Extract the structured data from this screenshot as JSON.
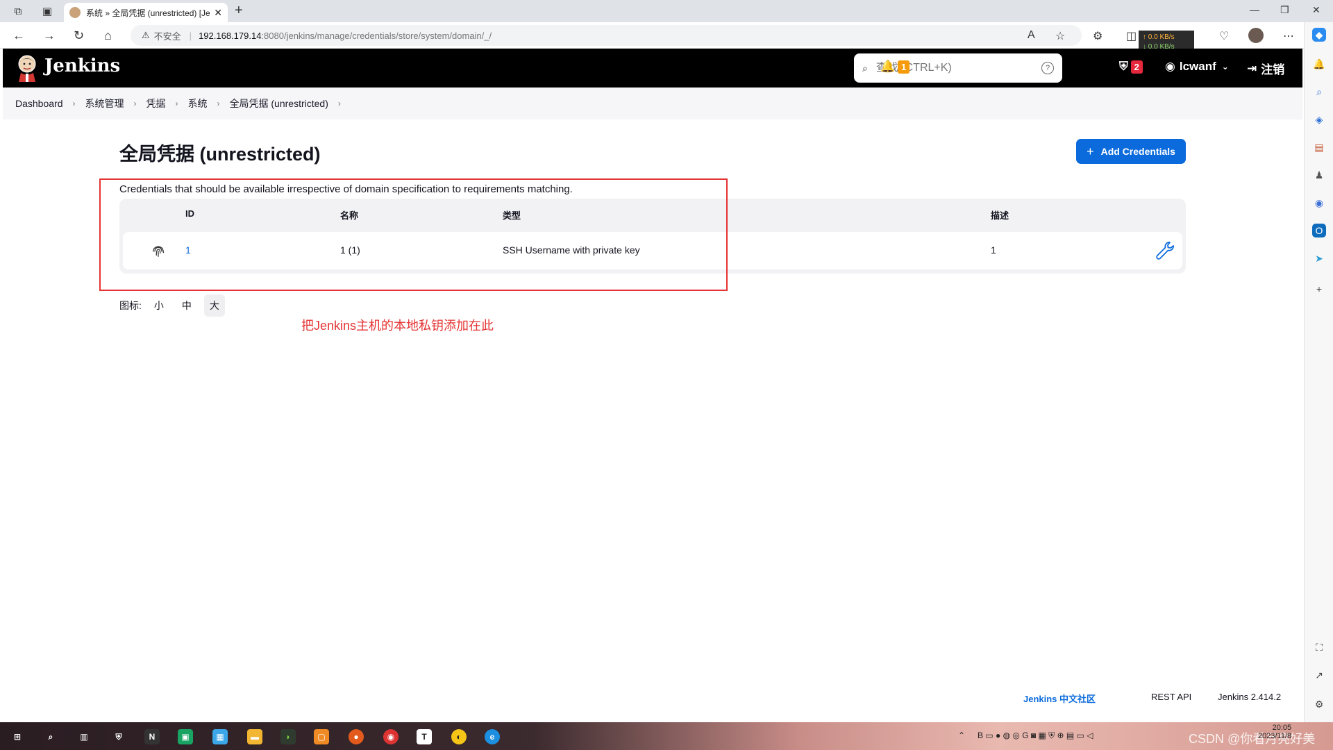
{
  "browser": {
    "tab_title": "系统 » 全局凭据 (unrestricted) [Je",
    "security_label": "不安全",
    "url_host": "192.168.179.14",
    "url_path": ":8080/jenkins/manage/credentials/store/system/domain/_/",
    "net_up": "↑ 0.0 KB/s",
    "net_down": "↓ 0.0 KB/s"
  },
  "header": {
    "brand": "Jenkins",
    "search_placeholder": "查找 (CTRL+K)",
    "notifications_count": "1",
    "security_count": "2",
    "user_name": "lcwanf",
    "logout_label": "注销"
  },
  "breadcrumb": [
    "Dashboard",
    "系统管理",
    "凭据",
    "系统",
    "全局凭据 (unrestricted)"
  ],
  "main": {
    "title": "全局凭据 (unrestricted)",
    "add_button": "Add Credentials",
    "description": "Credentials that should be available irrespective of domain specification to requirements matching.",
    "columns": [
      "ID",
      "名称",
      "类型",
      "描述"
    ],
    "rows": [
      {
        "id": "1",
        "name": "1 (1)",
        "type": "SSH Username with private key",
        "desc": "1"
      }
    ],
    "icon_size_label": "图标:",
    "icon_sizes": [
      "小",
      "中",
      "大"
    ],
    "active_icon_size": "大"
  },
  "annotation": "把Jenkins主机的本地私钥添加在此",
  "footer": {
    "community": "Jenkins 中文社区",
    "rest_api": "REST API",
    "version": "Jenkins 2.414.2"
  },
  "taskbar": {
    "watermark": "CSDN @你看月亮好美",
    "time": "20:05",
    "date": "2023/11/8"
  },
  "colors": {
    "jenkins_header": "#000000",
    "accent_blue": "#0b6bdc",
    "annotation_red": "#e53333",
    "badge_orange": "#f59b0c",
    "badge_red": "#e6283c"
  }
}
